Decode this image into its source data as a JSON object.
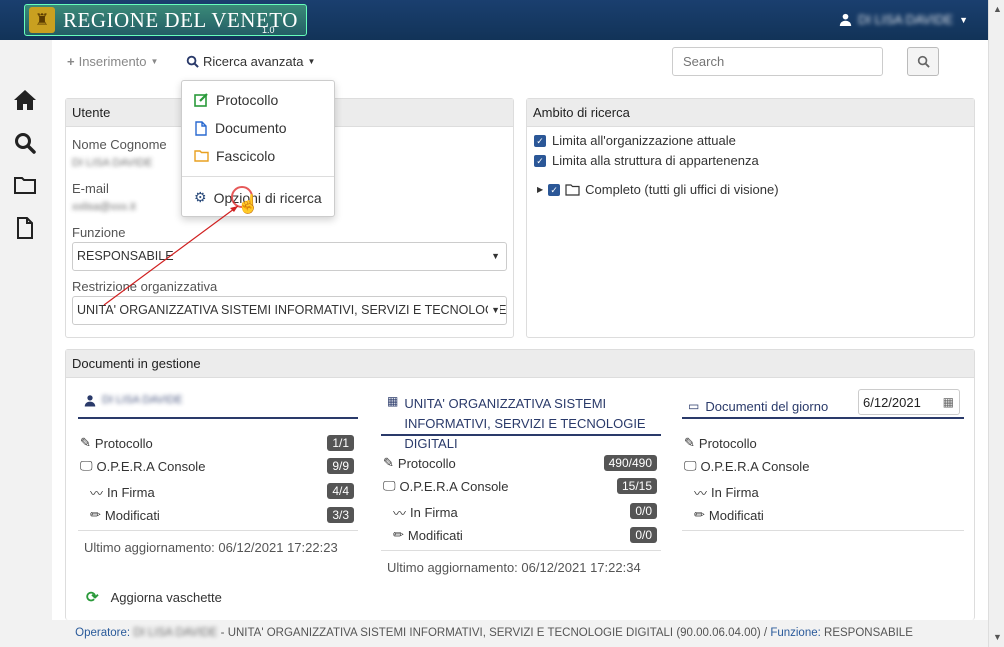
{
  "header": {
    "brand": "REGIONE DEL VENETO",
    "version": "1.0",
    "user_name": "DI LISA DAVIDE"
  },
  "toolbar": {
    "inserimento": "Inserimento",
    "ricerca_avanzata": "Ricerca avanzata",
    "search_placeholder": "Search"
  },
  "dropdown": {
    "items": [
      "Protocollo",
      "Documento",
      "Fascicolo"
    ],
    "options": "Opzioni di ricerca"
  },
  "utente": {
    "title": "Utente",
    "nome_label": "Nome Cognome",
    "nome_value": "DI LISA DAVIDE",
    "email_label": "E-mail",
    "email_value": "xxlisa@xxx.it",
    "funzione_label": "Funzione",
    "funzione_value": "RESPONSABILE",
    "restrizione_label": "Restrizione organizzativa",
    "restrizione_value": "UNITA' ORGANIZZATIVA SISTEMI INFORMATIVI, SERVIZI E TECNOLOGIE DIGITALI"
  },
  "ambito": {
    "title": "Ambito di ricerca",
    "opt1": "Limita all'organizzazione attuale",
    "opt2": "Limita alla struttura di appartenenza",
    "tree": "Completo (tutti gli uffici di visione)"
  },
  "documenti": {
    "title": "Documenti in gestione",
    "col1": {
      "head": "DI LISA DAVIDE",
      "rows": [
        {
          "label": "Protocollo",
          "badge": "1/1"
        },
        {
          "label": "O.P.E.R.A Console",
          "badge": "9/9"
        },
        {
          "label": "In Firma",
          "badge": "4/4"
        },
        {
          "label": "Modificati",
          "badge": "3/3"
        }
      ],
      "updated": "Ultimo aggiornamento: 06/12/2021 17:22:23"
    },
    "col2": {
      "head": "UNITA' ORGANIZZATIVA SISTEMI INFORMATIVI, SERVIZI E TECNOLOGIE DIGITALI",
      "rows": [
        {
          "label": "Protocollo",
          "badge": "490/490"
        },
        {
          "label": "O.P.E.R.A Console",
          "badge": "15/15"
        },
        {
          "label": "In Firma",
          "badge": "0/0"
        },
        {
          "label": "Modificati",
          "badge": "0/0"
        }
      ],
      "updated": "Ultimo aggiornamento: 06/12/2021 17:22:34"
    },
    "col3": {
      "head": "Documenti del giorno",
      "date": "6/12/2021",
      "rows": [
        {
          "label": "Protocollo"
        },
        {
          "label": "O.P.E.R.A Console"
        },
        {
          "label": "In Firma"
        },
        {
          "label": "Modificati"
        }
      ]
    },
    "refresh": "Aggiorna vaschette"
  },
  "footer": {
    "operatore_label": "Operatore:",
    "operatore_value": "DI LISA DAVIDE",
    "org": "- UNITA' ORGANIZZATIVA SISTEMI INFORMATIVI, SERVIZI E TECNOLOGIE DIGITALI (90.00.06.04.00) /",
    "funzione_label": "Funzione:",
    "funzione_value": "RESPONSABILE"
  },
  "colors": {
    "topbar": "#1a3f6f",
    "accent": "#2a3a6a",
    "badge": "#555555"
  }
}
